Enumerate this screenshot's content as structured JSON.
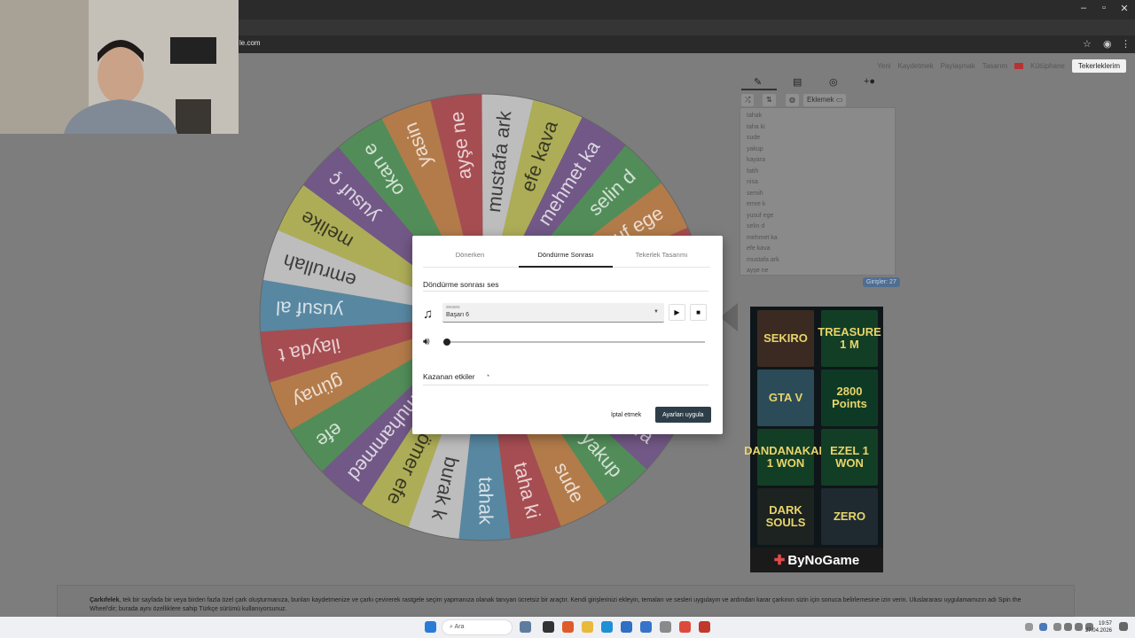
{
  "browser": {
    "url": "le.com",
    "controls": {
      "minimize": "–",
      "maximize": "▫",
      "close": "✕"
    }
  },
  "topnav": {
    "items": [
      "Yeni",
      "Kaydetmek",
      "Paylaşmak",
      "Tasarım",
      "Kütüphane"
    ],
    "login": "Tekerleklerim"
  },
  "wheel": {
    "segments": [
      {
        "label": "mustafa ark",
        "color": "#f2f2f2"
      },
      {
        "label": "efe kava",
        "color": "#d6d63b"
      },
      {
        "label": "mehmet ka",
        "color": "#6a3a8e"
      },
      {
        "label": "selin d",
        "color": "#2f9a3c"
      },
      {
        "label": "yusuf ege",
        "color": "#e07a20"
      },
      {
        "label": "emre k",
        "color": "#c9262f"
      },
      {
        "label": "semih",
        "color": "#3b8fbf"
      },
      {
        "label": "nisa",
        "color": "#f2f2f2"
      },
      {
        "label": "fatih",
        "color": "#d6d63b"
      },
      {
        "label": "kayara",
        "color": "#6a3a8e"
      },
      {
        "label": "yakup",
        "color": "#2f9a3c"
      },
      {
        "label": "sude",
        "color": "#e07a20"
      },
      {
        "label": "taha ki",
        "color": "#c9262f"
      },
      {
        "label": "tahak",
        "color": "#3b8fbf"
      },
      {
        "label": "burak k",
        "color": "#f2f2f2"
      },
      {
        "label": "ömer efe",
        "color": "#d6d63b"
      },
      {
        "label": "muhammed",
        "color": "#6a3a8e"
      },
      {
        "label": "efe",
        "color": "#2f9a3c"
      },
      {
        "label": "günay",
        "color": "#e07a20"
      },
      {
        "label": "ilayda t",
        "color": "#c9262f"
      },
      {
        "label": "yusuf al",
        "color": "#3b8fbf"
      },
      {
        "label": "emrullah",
        "color": "#f2f2f2"
      },
      {
        "label": "melike",
        "color": "#d6d63b"
      },
      {
        "label": "yusuf ç",
        "color": "#6a3a8e"
      },
      {
        "label": "okan e",
        "color": "#2f9a3c"
      },
      {
        "label": "yasin",
        "color": "#e07a20"
      },
      {
        "label": "ayşe ne",
        "color": "#c9262f"
      }
    ]
  },
  "panel": {
    "add_button": "Eklemek",
    "entries": [
      "tahak",
      "taha ki",
      "sude",
      "yakup",
      "kayara",
      "fatih",
      "nisa",
      "semih",
      "emre k",
      "yusuf ege",
      "selin d",
      "mehmet ka",
      "efe kava",
      "mustafa ark",
      "ayşe ne"
    ],
    "count_label": "Girişler: 27"
  },
  "ad": {
    "tiles": [
      {
        "text": "SEKIRO",
        "bg": "#3a2a22"
      },
      {
        "text": "TREASURE 1 M",
        "bg": "#123e25"
      },
      {
        "text": "GTA V",
        "bg": "#2b4b58"
      },
      {
        "text": "2800 Points",
        "bg": "#0e3a25"
      },
      {
        "text": "DANDANAKAN 1 WON",
        "bg": "#123e25"
      },
      {
        "text": "EZEL 1 WON",
        "bg": "#123e25"
      },
      {
        "text": "DARK SOULS",
        "bg": "#1c2320"
      },
      {
        "text": "ZERO",
        "bg": "#1e2a30"
      }
    ],
    "brand": "ByNoGame"
  },
  "footer": {
    "title": "Çarkıfelek",
    "text": ", tek bir sayfada bir veya birden fazla özel çark oluşturmanıza, bunları kaydetmenize ve çarkı çevirerek rastgele seçim yapmanıza olanak tanıyan ücretsiz bir araçtır. Kendi girişlerinizi ekleyin, temaları ve sesleri uygulayın ve ardından karar çarkının sizin için sonuca belirlemesine izin verin. Uluslararası uygulamamızın adı Spin the Wheel'dir; burada aynı özelliklere sahip Türkçe sürümü kullanıyorsunuz."
  },
  "modal": {
    "tabs": [
      "Dönerken",
      "Döndürme Sonrası",
      "Tekerlek Tasarımı"
    ],
    "active_tab": 1,
    "section_sound": "Döndürme sonrası ses",
    "select_label": "sesses",
    "select_value": "Başarı 6",
    "section_effects": "Kazanan etkiler",
    "cancel": "İptal etmek",
    "apply": "Ayarları uygula",
    "volume": 0.0
  },
  "taskbar": {
    "search_placeholder": "Ara",
    "time": "19:57",
    "date": "27.04.2026"
  }
}
